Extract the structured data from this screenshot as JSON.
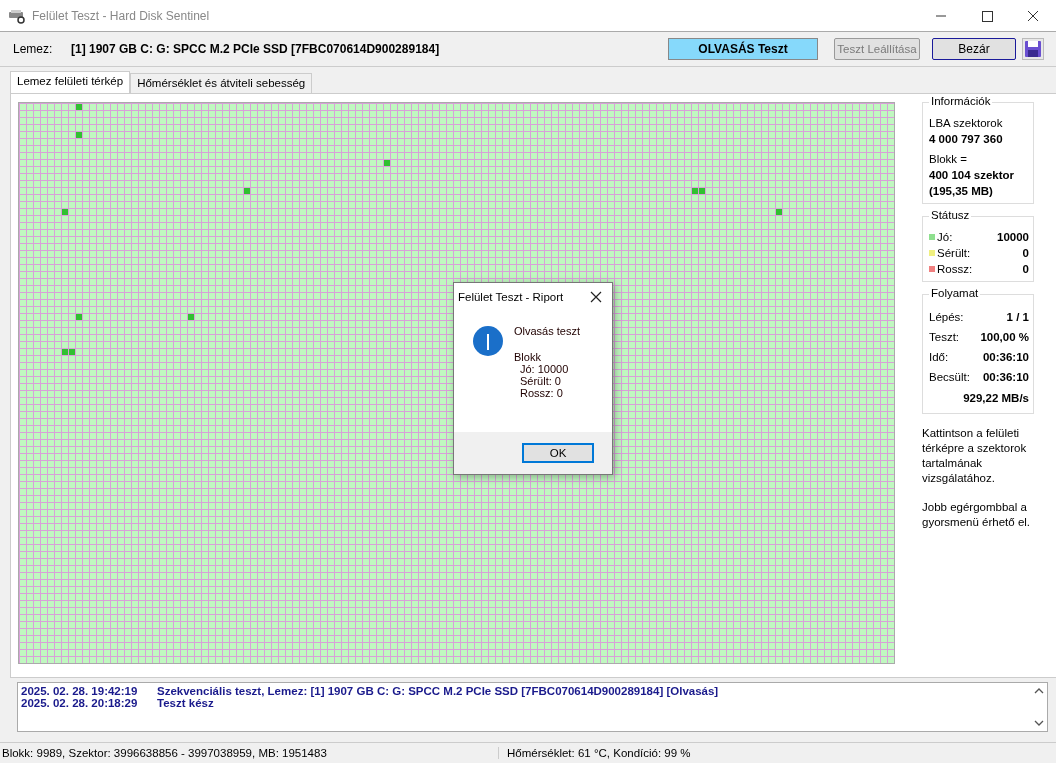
{
  "window": {
    "title": "Felület Teszt - Hard Disk Sentinel"
  },
  "toolbar": {
    "disk_label": "Lemez:",
    "disk_value": "[1] 1907 GB C: G: SPCC M.2 PCIe SSD [7FBC070614D900289184]",
    "test_mode": "OLVASÁS Teszt",
    "buttons": [
      {
        "label": "Teszt Leállítása",
        "disabled": true
      },
      {
        "label": "Bezár",
        "disabled": false
      }
    ]
  },
  "tabs": [
    {
      "label": "Lemez felületi térkép",
      "selected": true
    },
    {
      "label": "Hőmérséklet és átviteli sebesség",
      "selected": false
    }
  ],
  "info": {
    "title": "Információk",
    "lba_label": "LBA szektorok",
    "lba_value": "4 000 797 360",
    "block_label": "Blokk =",
    "block_value": "400 104 szektor",
    "block_size": "(195,35 MB)"
  },
  "status": {
    "title": "Státusz",
    "items": [
      {
        "label": "Jó:",
        "value": "10000",
        "color": "#8fe08f"
      },
      {
        "label": "Sérült:",
        "value": "0",
        "color": "#f0f080"
      },
      {
        "label": "Rossz:",
        "value": "0",
        "color": "#f08080"
      }
    ]
  },
  "progress": {
    "title": "Folyamat",
    "rows": [
      {
        "label": "Lépés:",
        "value": "1 / 1"
      },
      {
        "label": "Teszt:",
        "value": "100,00 %"
      },
      {
        "label": "Idő:",
        "value": "00:36:10"
      },
      {
        "label": "Becsült:",
        "value": "00:36:10"
      }
    ],
    "speed": "929,22 MB/s"
  },
  "hints": [
    "Kattintson a felületi térképre a szektorok tartalmának vizsgálatához.",
    "Jobb egérgombbal a gyorsmenü érhető el."
  ],
  "dialog": {
    "title": "Felület Teszt - Riport",
    "heading": "Olvasás teszt",
    "block_label": "Blokk",
    "lines": [
      "Jó: 10000",
      "Sérült: 0",
      "Rossz: 0"
    ],
    "button": "OK"
  },
  "log": [
    {
      "time": "2025. 02. 28.  19:42:19",
      "message": "Szekvenciális teszt, Lemez: [1] 1907 GB C: G: SPCC M.2 PCIe SSD [7FBC070614D900289184] [Olvasás]"
    },
    {
      "time": "2025. 02. 28.  20:18:29",
      "message": "Teszt kész"
    }
  ],
  "status_bar": [
    "Blokk: 9989, Szektor: 3996638856 - 3997038959, MB: 1951483",
    "Hőmérséklet: 61  °C,  Kondíció: 99 %"
  ]
}
